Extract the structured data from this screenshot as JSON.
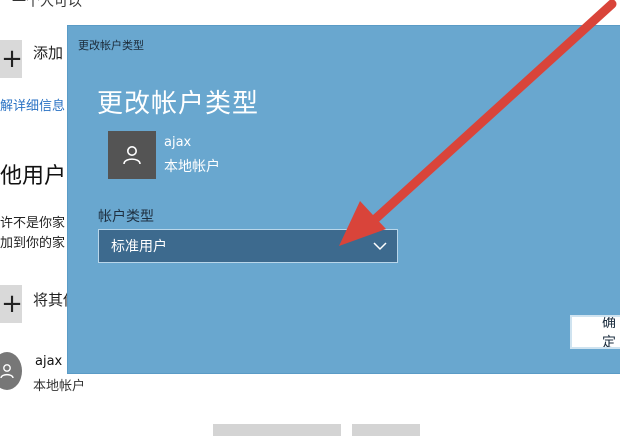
{
  "background": {
    "top_text": "一个人可以",
    "add_family_label": "添加",
    "details_link": "解详细信息",
    "other_users_heading": "他用户",
    "desc_line1": "许不是你家",
    "desc_line2": "加到你的家",
    "add_other_label": "将其他",
    "user": {
      "name": "ajax",
      "type": "本地帐户"
    }
  },
  "dialog": {
    "title_bar": "更改帐户类型",
    "heading": "更改帐户类型",
    "user": {
      "name": "ajax",
      "type": "本地帐户"
    },
    "account_type_label": "帐户类型",
    "account_type_selected": "标准用户",
    "ok_label": "确定"
  },
  "colors": {
    "dialog_bg": "#69a7cf",
    "select_bg": "#3d6a8e",
    "arrow": "#d9443a"
  },
  "icons": [
    "plus-icon",
    "person-icon",
    "chevron-down-icon",
    "arrow-annotation"
  ]
}
